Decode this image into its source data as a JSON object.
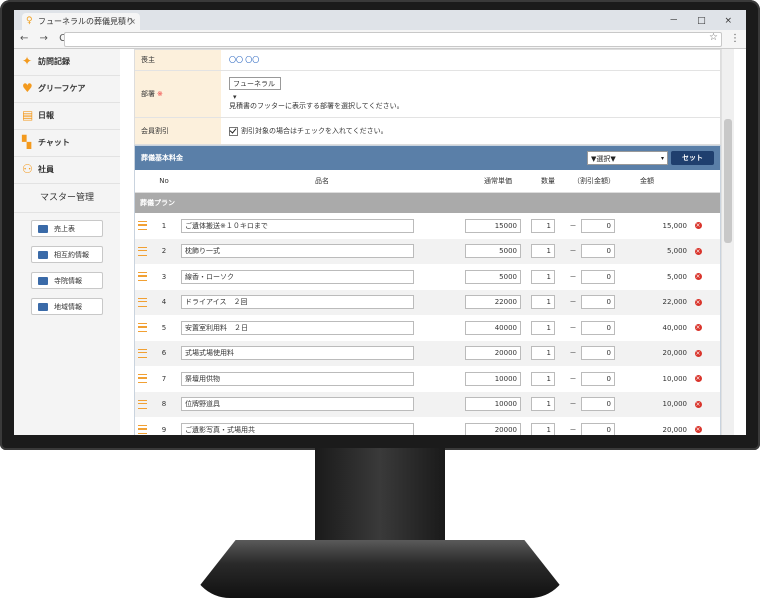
{
  "browser": {
    "tab_title": "フューネラルの葬儀見積り",
    "tab_close": "×",
    "window_buttons": "－ □ ×",
    "nav": "← → C",
    "star": "☆",
    "menu": "⋮"
  },
  "sidebar": {
    "items": [
      {
        "label": "訪問記録",
        "icon": "walking-person-icon"
      },
      {
        "label": "グリーフケア",
        "icon": "heart-icon"
      },
      {
        "label": "日報",
        "icon": "notepad-icon"
      },
      {
        "label": "チャット",
        "icon": "chat-icon"
      },
      {
        "label": "社員",
        "icon": "people-icon"
      }
    ],
    "master_heading": "マスター管理",
    "buttons": [
      {
        "label": "売上表"
      },
      {
        "label": "相互約情報"
      },
      {
        "label": "寺院情報"
      },
      {
        "label": "地域情報"
      }
    ]
  },
  "form": {
    "rows": [
      {
        "label": "喪主",
        "value": "〇〇 〇〇"
      },
      {
        "label": "部署",
        "required": "※",
        "select": "フューネラル ▾",
        "help": "見積書のフッターに表示する部署を選択してください。"
      },
      {
        "label": "会員割引",
        "help": "割引対象の場合はチェックを入れてください。"
      }
    ]
  },
  "panel": {
    "title": "葬儀基本料金",
    "select": "▼選択▼",
    "select_arrow": "▾",
    "set_button": "セット",
    "columns": {
      "no": "No",
      "name": "品名",
      "price": "通常単価",
      "qty": "数量",
      "discount": "（割引金額）",
      "amount": "金額"
    },
    "category": "葬儀プラン",
    "dash": "－",
    "rows": [
      {
        "no": "1",
        "name": "ご遺体搬送※１０キロまで",
        "price": "15000",
        "qty": "1",
        "disc": "0",
        "amount": "15,000"
      },
      {
        "no": "2",
        "name": "枕飾り一式",
        "price": "5000",
        "qty": "1",
        "disc": "0",
        "amount": "5,000"
      },
      {
        "no": "3",
        "name": "線香・ローソク",
        "price": "5000",
        "qty": "1",
        "disc": "0",
        "amount": "5,000"
      },
      {
        "no": "4",
        "name": "ドライアイス　２回",
        "price": "22000",
        "qty": "1",
        "disc": "0",
        "amount": "22,000"
      },
      {
        "no": "5",
        "name": "安置室利用料　２日",
        "price": "40000",
        "qty": "1",
        "disc": "0",
        "amount": "40,000"
      },
      {
        "no": "6",
        "name": "式場式場使用料",
        "price": "20000",
        "qty": "1",
        "disc": "0",
        "amount": "20,000"
      },
      {
        "no": "7",
        "name": "祭壇用供物",
        "price": "10000",
        "qty": "1",
        "disc": "0",
        "amount": "10,000"
      },
      {
        "no": "8",
        "name": "位牌野道具",
        "price": "10000",
        "qty": "1",
        "disc": "0",
        "amount": "10,000"
      },
      {
        "no": "9",
        "name": "ご遺影写真・式場用共",
        "price": "20000",
        "qty": "1",
        "disc": "0",
        "amount": "20,000"
      }
    ]
  }
}
